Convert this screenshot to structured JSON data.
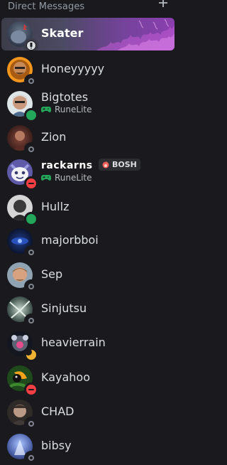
{
  "header": {
    "title": "Direct Messages",
    "add_icon": "plus-icon"
  },
  "colors": {
    "background": "#1a1a1e",
    "online": "#23a55a",
    "dnd": "#f23f43",
    "idle": "#f0b232",
    "offline": "#80848e",
    "game_activity": "#23a55a"
  },
  "dms": [
    {
      "name": "Skater",
      "status": "mobile",
      "active": true
    },
    {
      "name": "Honeyyyyy",
      "status": "offline"
    },
    {
      "name": "Bigtotes",
      "status": "online",
      "activity": "RuneLite",
      "activity_icon": "gamepad-icon"
    },
    {
      "name": "Zion",
      "status": "offline"
    },
    {
      "name": "rackarns",
      "status": "dnd",
      "activity": "RuneLite",
      "activity_icon": "gamepad-icon",
      "tag": "BOSH",
      "tag_icon": "flame-icon"
    },
    {
      "name": "Hullz",
      "status": "online"
    },
    {
      "name": "majorbboi",
      "status": "offline"
    },
    {
      "name": "Sep",
      "status": "offline"
    },
    {
      "name": "Sinjutsu",
      "status": "offline"
    },
    {
      "name": "heavierrain",
      "status": "idle"
    },
    {
      "name": "Kayahoo",
      "status": "dnd"
    },
    {
      "name": "CHAD",
      "status": "offline"
    },
    {
      "name": "bibsy",
      "status": "offline"
    }
  ]
}
